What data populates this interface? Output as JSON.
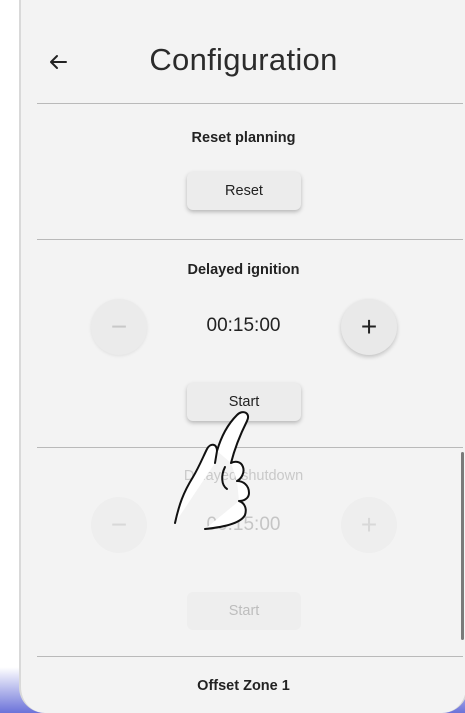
{
  "header": {
    "back_icon": "arrow-left-icon",
    "title": "Configuration"
  },
  "reset_planning": {
    "title": "Reset planning",
    "button_label": "Reset"
  },
  "delayed_ignition": {
    "title": "Delayed ignition",
    "minus": "−",
    "plus": "+",
    "time": "00:15:00",
    "button_label": "Start"
  },
  "delayed_shutdown": {
    "title": "Delayed shutdown",
    "minus": "−",
    "plus": "+",
    "time": "00:15:00",
    "button_label": "Start"
  },
  "offset_zone": {
    "title": "Offset Zone 1"
  },
  "colors": {
    "bezel_accent": "#6b72d9",
    "background": "#f3f3f3"
  },
  "overlay": {
    "gesture_icon": "tap-hand-icon"
  }
}
